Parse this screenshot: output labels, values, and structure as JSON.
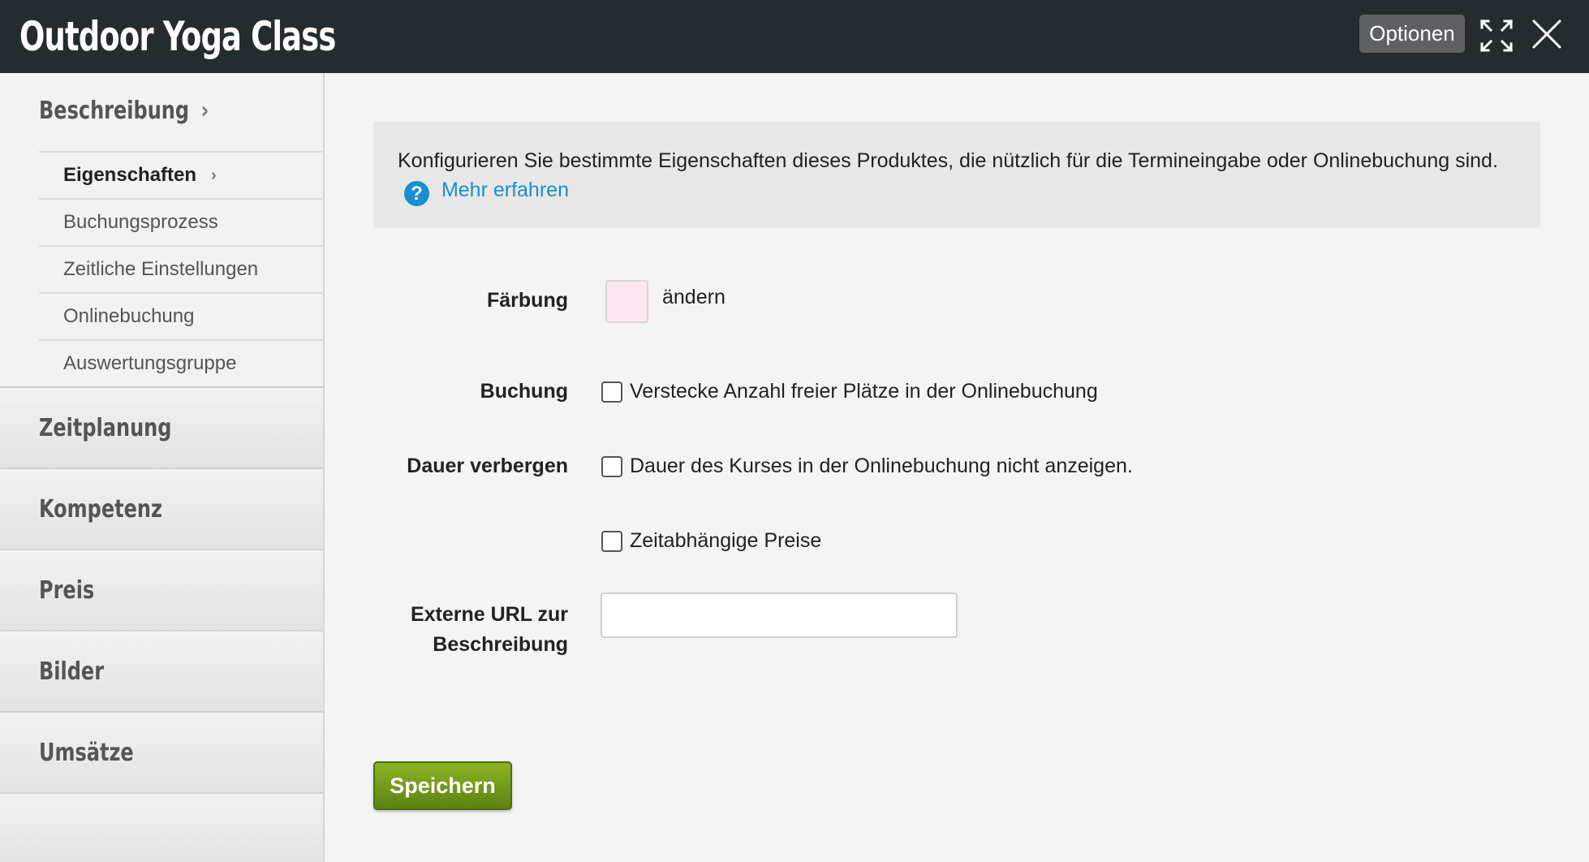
{
  "header": {
    "title": "Outdoor Yoga Class",
    "options_label": "Optionen",
    "fullscreen_icon": "fullscreen-icon",
    "close_icon": "close-icon"
  },
  "sidebar": {
    "open_section": {
      "label": "Beschreibung",
      "items": [
        {
          "label": "Eigenschaften",
          "active": true
        },
        {
          "label": "Buchungsprozess"
        },
        {
          "label": "Zeitliche Einstellungen"
        },
        {
          "label": "Onlinebuchung"
        },
        {
          "label": "Auswertungsgruppe"
        }
      ]
    },
    "sections": [
      {
        "label": "Zeitplanung"
      },
      {
        "label": "Kompetenz"
      },
      {
        "label": "Preis"
      },
      {
        "label": "Bilder"
      },
      {
        "label": "Umsätze"
      }
    ]
  },
  "info": {
    "text": "Konfigurieren Sie bestimmte Eigenschaften dieses Produktes, die nützlich für die Termineingabe oder Onlinebuchung sind.",
    "help_icon": "?",
    "link": "Mehr erfahren"
  },
  "form": {
    "color_label": "Färbung",
    "color_value": "#fde6f0",
    "color_change": "ändern",
    "booking_label": "Buchung",
    "booking_checkbox": "Verstecke Anzahl freier Plätze in der Onlinebuchung",
    "duration_label": "Dauer verbergen",
    "duration_checkbox": "Dauer des Kurses in der Onlinebuchung nicht anzeigen.",
    "time_prices_checkbox": "Zeitabhängige Preise",
    "url_label_1": "Externe URL zur",
    "url_label_2": "Beschreibung",
    "url_value": "",
    "save_label": "Speichern"
  },
  "colors": {
    "header_bg": "#242c30",
    "link": "#1a8fd0",
    "save_button": "#6f9a1a"
  }
}
